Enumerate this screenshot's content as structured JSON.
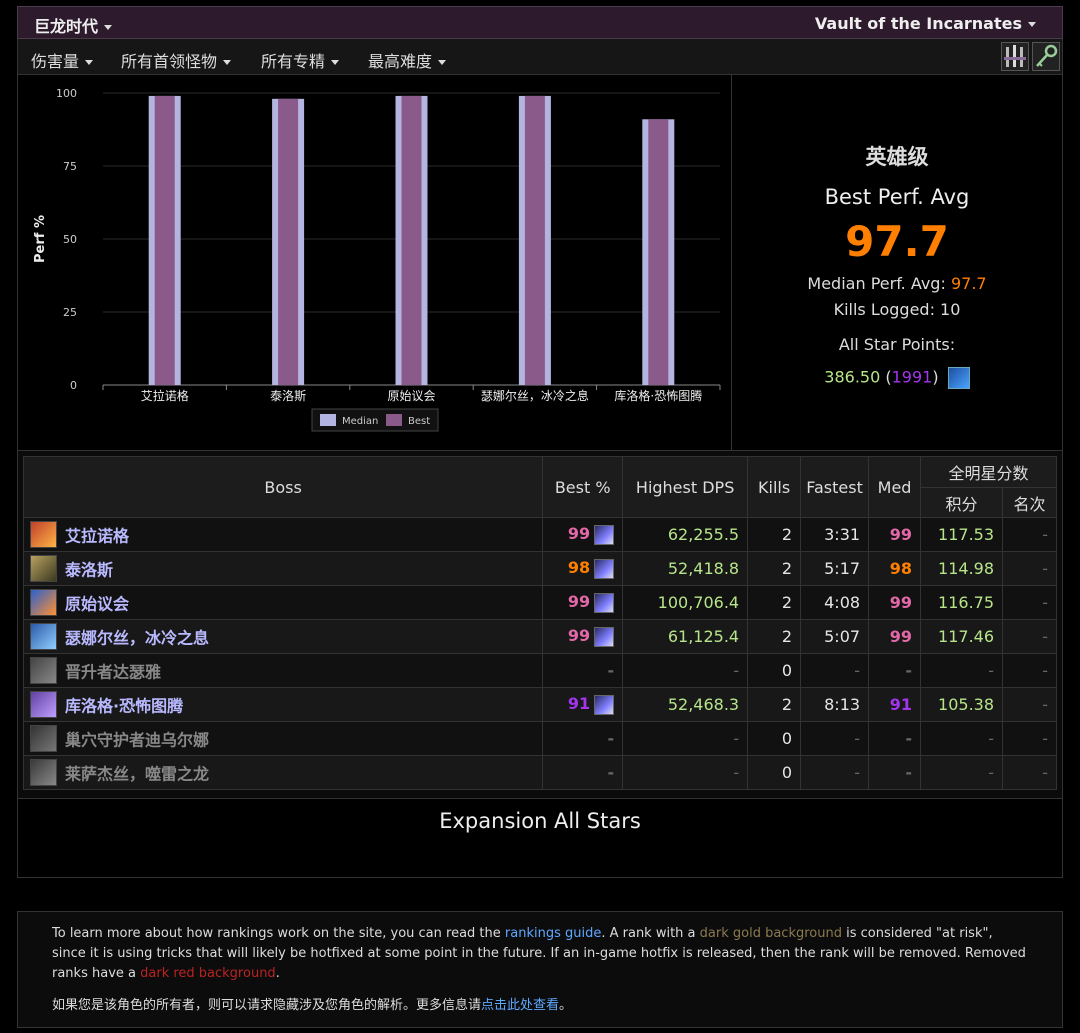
{
  "header": {
    "expansion": "巨龙时代",
    "zone": "Vault of the Incarnates"
  },
  "filters": {
    "metric": "伤害量",
    "bosses": "所有首领怪物",
    "specs": "所有专精",
    "difficulty": "最高难度"
  },
  "chart_data": {
    "type": "bar",
    "categories": [
      "艾拉诺格",
      "泰洛斯",
      "原始议会",
      "瑟娜尔丝，冰冷之息",
      "库洛格·恐怖图腾"
    ],
    "series": [
      {
        "name": "Median",
        "values": [
          99,
          98,
          99,
          99,
          91
        ]
      },
      {
        "name": "Best",
        "values": [
          99,
          98,
          99,
          99,
          91
        ]
      }
    ],
    "ylabel": "Perf %",
    "ylim": [
      0,
      100
    ],
    "yticks": [
      0,
      25,
      50,
      75,
      100
    ],
    "colors": {
      "Median": "#b4b4e0",
      "Best": "#8a5a8a"
    },
    "legend": "bottom-center"
  },
  "summary": {
    "difficulty": "英雄级",
    "best_label": "Best Perf. Avg",
    "best_value": "97.7",
    "median_label": "Median Perf. Avg:",
    "median_value": "97.7",
    "kills_label": "Kills Logged:",
    "kills_value": "10",
    "star_label": "All Star Points:",
    "star_points": "386.50",
    "star_rank": "1991"
  },
  "table": {
    "headers": {
      "boss": "Boss",
      "best": "Best %",
      "dps": "Highest DPS",
      "kills": "Kills",
      "fastest": "Fastest",
      "med": "Med",
      "allstar": "全明星分数",
      "points": "积分",
      "rank": "名次"
    },
    "rows": [
      {
        "name": "艾拉诺格",
        "best": "99",
        "dps": "62,255.5",
        "kills": "2",
        "fastest": "3:31",
        "med": "99",
        "points": "117.53",
        "rank": "-"
      },
      {
        "name": "泰洛斯",
        "best": "98",
        "dps": "52,418.8",
        "kills": "2",
        "fastest": "5:17",
        "med": "98",
        "points": "114.98",
        "rank": "-"
      },
      {
        "name": "原始议会",
        "best": "99",
        "dps": "100,706.4",
        "kills": "2",
        "fastest": "4:08",
        "med": "99",
        "points": "116.75",
        "rank": "-"
      },
      {
        "name": "瑟娜尔丝，冰冷之息",
        "best": "99",
        "dps": "61,125.4",
        "kills": "2",
        "fastest": "5:07",
        "med": "99",
        "points": "117.46",
        "rank": "-"
      },
      {
        "name": "晋升者达瑟雅",
        "best": "-",
        "dps": "-",
        "kills": "0",
        "fastest": "-",
        "med": "-",
        "points": "-",
        "rank": "-"
      },
      {
        "name": "库洛格·恐怖图腾",
        "best": "91",
        "dps": "52,468.3",
        "kills": "2",
        "fastest": "8:13",
        "med": "91",
        "points": "105.38",
        "rank": "-"
      },
      {
        "name": "巢穴守护者迪乌尔娜",
        "best": "-",
        "dps": "-",
        "kills": "0",
        "fastest": "-",
        "med": "-",
        "points": "-",
        "rank": "-"
      },
      {
        "name": "莱萨杰丝，噬雷之龙",
        "best": "-",
        "dps": "-",
        "kills": "0",
        "fastest": "-",
        "med": "-",
        "points": "-",
        "rank": "-"
      }
    ]
  },
  "expansion_stars": {
    "title": "Expansion All Stars"
  },
  "footer": {
    "p1_a": "To learn more about how rankings work on the site, you can read the ",
    "p1_link": "rankings guide",
    "p1_b": ". A rank with a ",
    "p1_gold": "dark gold background",
    "p1_c": " is considered \"at risk\", since it is using tricks that will likely be hotfixed at some point in the future. If an in-game hotfix is released, then the rank will be removed. Removed ranks have a ",
    "p1_red": "dark red background",
    "p1_d": ".",
    "p2_a": "如果您是该角色的所有者，则可以请求隐藏涉及您角色的解析。更多信息请",
    "p2_link": "点击此处查看",
    "p2_b": "。"
  }
}
